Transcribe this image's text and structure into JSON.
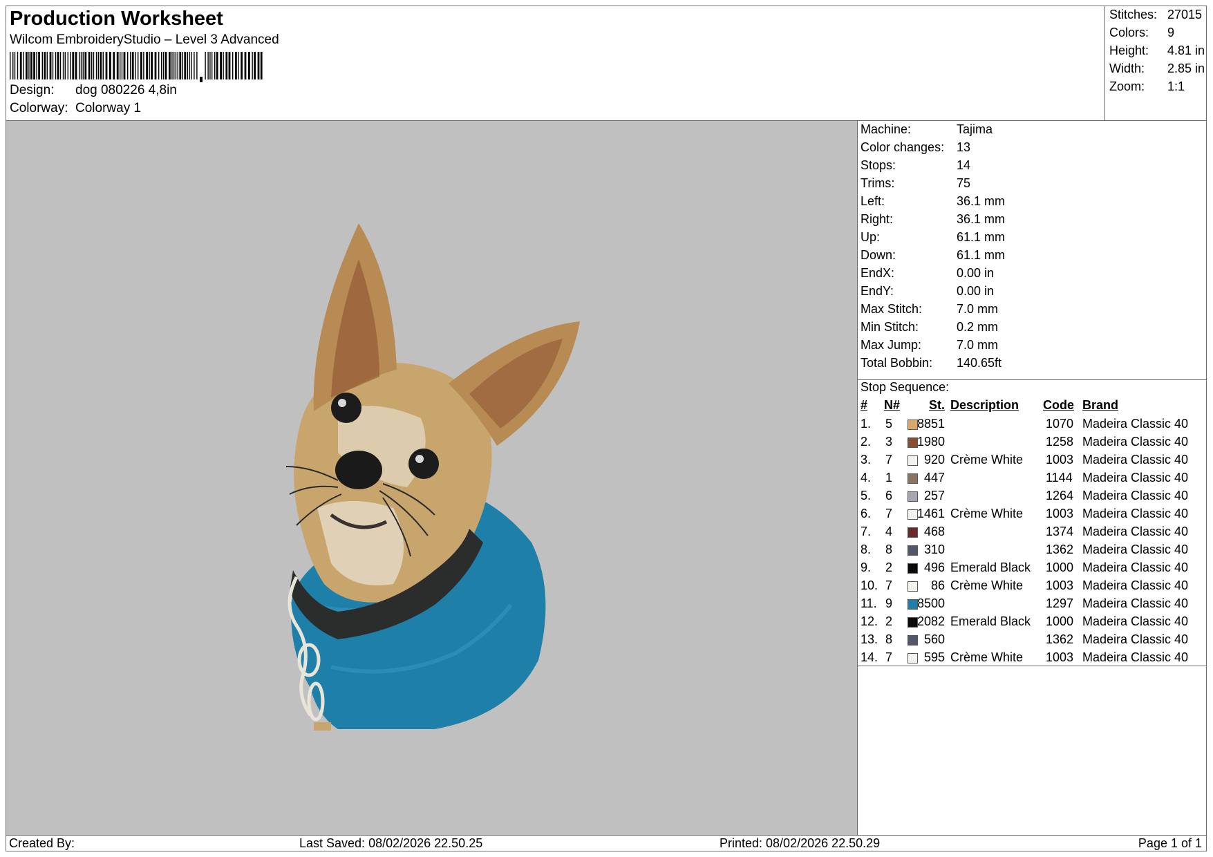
{
  "header": {
    "title": "Production Worksheet",
    "subtitle": "Wilcom EmbroideryStudio – Level 3 Advanced",
    "design_label": "Design:",
    "design_value": "dog 080226 4,8in",
    "colorway_label": "Colorway:",
    "colorway_value": "Colorway 1"
  },
  "summary": [
    {
      "label": "Stitches:",
      "value": "27015"
    },
    {
      "label": "Colors:",
      "value": "9"
    },
    {
      "label": "Height:",
      "value": "4.81 in"
    },
    {
      "label": "Width:",
      "value": "2.85 in"
    },
    {
      "label": "Zoom:",
      "value": "1:1"
    }
  ],
  "machine": [
    {
      "label": "Machine:",
      "value": "Tajima"
    },
    {
      "label": "Color changes:",
      "value": "13"
    },
    {
      "label": "Stops:",
      "value": "14"
    },
    {
      "label": "Trims:",
      "value": "75"
    },
    {
      "label": "Left:",
      "value": "36.1 mm"
    },
    {
      "label": "Right:",
      "value": "36.1 mm"
    },
    {
      "label": "Up:",
      "value": "61.1 mm"
    },
    {
      "label": "Down:",
      "value": "61.1 mm"
    },
    {
      "label": "EndX:",
      "value": "0.00 in"
    },
    {
      "label": "EndY:",
      "value": "0.00 in"
    },
    {
      "label": "Max Stitch:",
      "value": "7.0 mm"
    },
    {
      "label": "Min Stitch:",
      "value": "0.2 mm"
    },
    {
      "label": "Max Jump:",
      "value": "7.0 mm"
    },
    {
      "label": "Total Bobbin:",
      "value": "140.65ft"
    }
  ],
  "stop_sequence": {
    "title": "Stop Sequence:",
    "headers": {
      "num": "#",
      "n": "N#",
      "st": "St.",
      "desc": "Description",
      "code": "Code",
      "brand": "Brand"
    },
    "rows": [
      {
        "num": "1.",
        "n": "5",
        "color": "#d9a869",
        "st": "8851",
        "desc": "",
        "code": "1070",
        "brand": "Madeira Classic 40"
      },
      {
        "num": "2.",
        "n": "3",
        "color": "#8a4d2d",
        "st": "1980",
        "desc": "",
        "code": "1258",
        "brand": "Madeira Classic 40"
      },
      {
        "num": "3.",
        "n": "7",
        "color": "#f2f2ee",
        "st": "920",
        "desc": "Crème White",
        "code": "1003",
        "brand": "Madeira Classic 40"
      },
      {
        "num": "4.",
        "n": "1",
        "color": "#8c7260",
        "st": "447",
        "desc": "",
        "code": "1144",
        "brand": "Madeira Classic 40"
      },
      {
        "num": "5.",
        "n": "6",
        "color": "#a7a4b4",
        "st": "257",
        "desc": "",
        "code": "1264",
        "brand": "Madeira Classic 40"
      },
      {
        "num": "6.",
        "n": "7",
        "color": "#f2f2ee",
        "st": "1461",
        "desc": "Crème White",
        "code": "1003",
        "brand": "Madeira Classic 40"
      },
      {
        "num": "7.",
        "n": "4",
        "color": "#6b2a2a",
        "st": "468",
        "desc": "",
        "code": "1374",
        "brand": "Madeira Classic 40"
      },
      {
        "num": "8.",
        "n": "8",
        "color": "#55566a",
        "st": "310",
        "desc": "",
        "code": "1362",
        "brand": "Madeira Classic 40"
      },
      {
        "num": "9.",
        "n": "2",
        "color": "#0a0a0a",
        "st": "496",
        "desc": "Emerald Black",
        "code": "1000",
        "brand": "Madeira Classic 40"
      },
      {
        "num": "10.",
        "n": "7",
        "color": "#f2f2ee",
        "st": "86",
        "desc": "Crème White",
        "code": "1003",
        "brand": "Madeira Classic 40"
      },
      {
        "num": "11.",
        "n": "9",
        "color": "#1e7fa8",
        "st": "8500",
        "desc": "",
        "code": "1297",
        "brand": "Madeira Classic 40"
      },
      {
        "num": "12.",
        "n": "2",
        "color": "#0a0a0a",
        "st": "2082",
        "desc": "Emerald Black",
        "code": "1000",
        "brand": "Madeira Classic 40"
      },
      {
        "num": "13.",
        "n": "8",
        "color": "#55566a",
        "st": "560",
        "desc": "",
        "code": "1362",
        "brand": "Madeira Classic 40"
      },
      {
        "num": "14.",
        "n": "7",
        "color": "#f2f2ee",
        "st": "595",
        "desc": "Crème White",
        "code": "1003",
        "brand": "Madeira Classic 40"
      }
    ]
  },
  "footer": {
    "created_by": "Created By:",
    "last_saved": "Last Saved: 08/02/2026 22.50.25",
    "printed": "Printed: 08/02/2026 22.50.29",
    "page": "Page 1 of 1"
  },
  "colors": {
    "background": "#c0c0c0",
    "sweater": "#1e7fa8",
    "fur": "#c9a56e",
    "ear_brown": "#8a4d2d"
  }
}
